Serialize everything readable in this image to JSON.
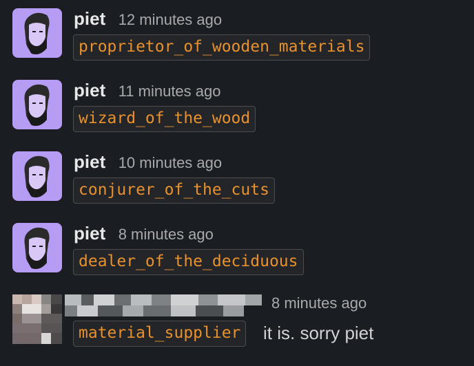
{
  "messages": [
    {
      "author": "piet",
      "time": "12 minutes ago",
      "code": "proprietor_of_wooden_materials"
    },
    {
      "author": "piet",
      "time": "11 minutes ago",
      "code": "wizard_of_the_wood"
    },
    {
      "author": "piet",
      "time": "10 minutes ago",
      "code": "conjurer_of_the_cuts"
    },
    {
      "author": "piet",
      "time": "8 minutes ago",
      "code": "dealer_of_the_deciduous"
    }
  ],
  "last_message": {
    "time": "8 minutes ago",
    "code": "material_supplier",
    "text": "it is. sorry piet"
  },
  "colors": {
    "background": "#1a1d21",
    "code_text": "#e8912d",
    "avatar_bg": "#b69cf3",
    "author": "#e8e8e8",
    "timestamp": "#a8aaad"
  }
}
